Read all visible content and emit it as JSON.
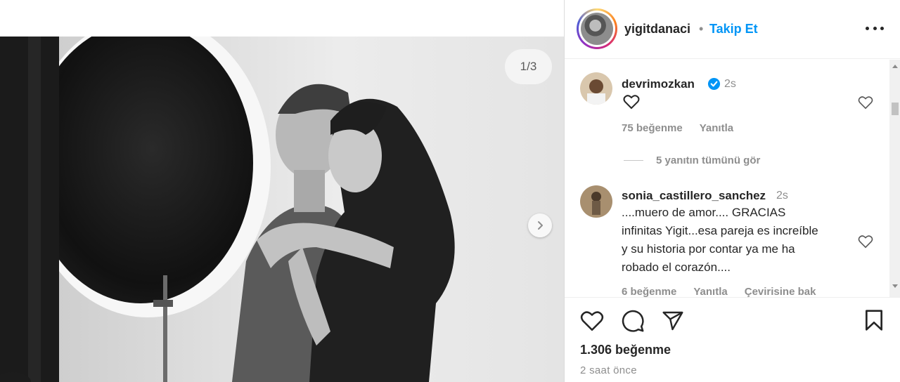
{
  "post": {
    "author": "yigitdanaci",
    "separator": "•",
    "follow_label": "Takip Et",
    "slide_counter": "1/3",
    "likes": "1.306 beğenme",
    "time_ago": "2 saat önce"
  },
  "comments": [
    {
      "username": "devrimozkan",
      "verified": true,
      "time": "2s",
      "text": "♡",
      "likes": "75 beğenme",
      "reply_label": "Yanıtla",
      "view_replies": "5 yanıtın tümünü gör"
    },
    {
      "username": "sonia_castillero_sanchez",
      "verified": false,
      "time": "2s",
      "text_lines": [
        "....muero de amor.... GRACIAS",
        "infinitas Yigit...esa pareja es increíble",
        "y su historia por contar ya me ha",
        "robado el corazón...."
      ],
      "likes": "6 beğenme",
      "reply_label": "Yanıtla",
      "translate_label": "Çevirisine bak"
    }
  ],
  "icons": {
    "more": "more-options-icon",
    "like": "heart-icon",
    "comment": "comment-icon",
    "share": "share-icon",
    "save": "bookmark-icon",
    "next": "chevron-right-icon"
  },
  "colors": {
    "link_blue": "#0095f6",
    "text": "#262626",
    "secondary": "#8e8e8e"
  }
}
